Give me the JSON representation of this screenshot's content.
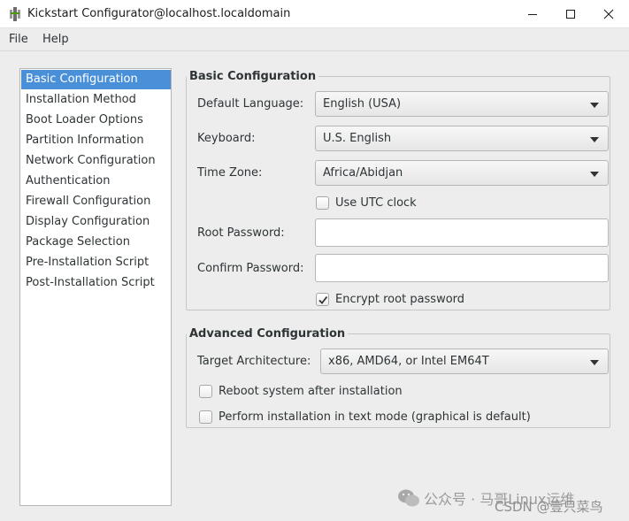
{
  "window": {
    "title": "Kickstart Configurator@localhost.localdomain"
  },
  "menu": {
    "file": "File",
    "help": "Help"
  },
  "sidebar": {
    "items": [
      {
        "label": "Basic Configuration",
        "selected": true
      },
      {
        "label": "Installation Method"
      },
      {
        "label": "Boot Loader Options"
      },
      {
        "label": "Partition Information"
      },
      {
        "label": "Network Configuration"
      },
      {
        "label": "Authentication"
      },
      {
        "label": "Firewall Configuration"
      },
      {
        "label": "Display Configuration"
      },
      {
        "label": "Package Selection"
      },
      {
        "label": "Pre-Installation Script"
      },
      {
        "label": "Post-Installation Script"
      }
    ]
  },
  "basic": {
    "title": "Basic Configuration",
    "language_label": "Default Language:",
    "language_value": "English (USA)",
    "keyboard_label": "Keyboard:",
    "keyboard_value": "U.S. English",
    "timezone_label": "Time Zone:",
    "timezone_value": "Africa/Abidjan",
    "utc_label": "Use UTC clock",
    "utc_checked": false,
    "root_password_label": "Root Password:",
    "root_password_value": "",
    "confirm_password_label": "Confirm Password:",
    "confirm_password_value": "",
    "encrypt_label": "Encrypt root password",
    "encrypt_checked": true
  },
  "advanced": {
    "title": "Advanced Configuration",
    "arch_label": "Target Architecture:",
    "arch_value": "x86, AMD64, or Intel EM64T",
    "reboot_label": "Reboot system after installation",
    "reboot_checked": false,
    "textmode_label": "Perform installation in text mode (graphical is default)",
    "textmode_checked": false
  },
  "watermark": {
    "line1": "公众号 · 马哥Linux运维",
    "line2": "CSDN @壹只菜鸟"
  },
  "colors": {
    "selection": "#4a90d9",
    "window_bg": "#ededed"
  }
}
